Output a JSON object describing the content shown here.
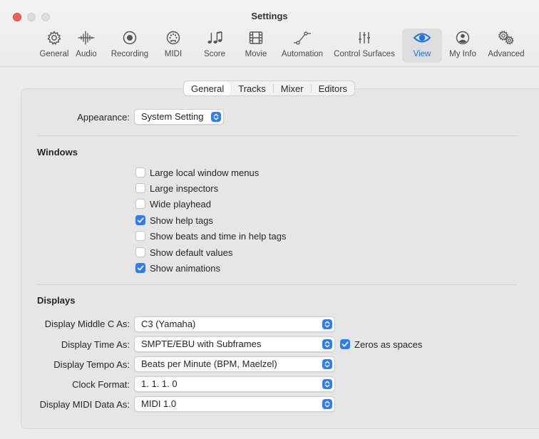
{
  "window": {
    "title": "Settings"
  },
  "toolbar": {
    "items": [
      {
        "label": "General",
        "icon": "gear-icon"
      },
      {
        "label": "Audio",
        "icon": "waveform-icon"
      },
      {
        "label": "Recording",
        "icon": "record-icon"
      },
      {
        "label": "MIDI",
        "icon": "midi-port-icon"
      },
      {
        "label": "Score",
        "icon": "music-notes-icon"
      },
      {
        "label": "Movie",
        "icon": "film-icon"
      },
      {
        "label": "Automation",
        "icon": "automation-curve-icon"
      },
      {
        "label": "Control Surfaces",
        "icon": "sliders-icon"
      },
      {
        "label": "View",
        "icon": "eye-icon",
        "active": true
      },
      {
        "label": "My Info",
        "icon": "person-icon"
      },
      {
        "label": "Advanced",
        "icon": "gears-icon"
      }
    ],
    "accent": "#1a73e8"
  },
  "tabs": [
    "General",
    "Tracks",
    "Mixer",
    "Editors"
  ],
  "active_tab": "General",
  "appearance": {
    "label": "Appearance:",
    "value": "System Setting"
  },
  "windows": {
    "title": "Windows",
    "options": [
      {
        "label": "Large local window menus",
        "checked": false
      },
      {
        "label": "Large inspectors",
        "checked": false
      },
      {
        "label": "Wide playhead",
        "checked": false
      },
      {
        "label": "Show help tags",
        "checked": true
      },
      {
        "label": "Show beats and time in help tags",
        "checked": false
      },
      {
        "label": "Show default values",
        "checked": false
      },
      {
        "label": "Show animations",
        "checked": true
      }
    ]
  },
  "displays": {
    "title": "Displays",
    "rows": [
      {
        "label": "Display Middle C As:",
        "value": "C3 (Yamaha)"
      },
      {
        "label": "Display Time As:",
        "value": "SMPTE/EBU with Subframes"
      },
      {
        "label": "Display Tempo As:",
        "value": "Beats per Minute (BPM, Maelzel)"
      },
      {
        "label": "Clock Format:",
        "value": "1. 1. 1. 0"
      },
      {
        "label": "Display MIDI Data As:",
        "value": "MIDI 1.0"
      }
    ],
    "zeros_as_spaces": {
      "label": "Zeros as spaces",
      "checked": true
    }
  },
  "colors": {
    "checkbox_blue": "#2f7df6",
    "close_red": "#fe5f57"
  }
}
